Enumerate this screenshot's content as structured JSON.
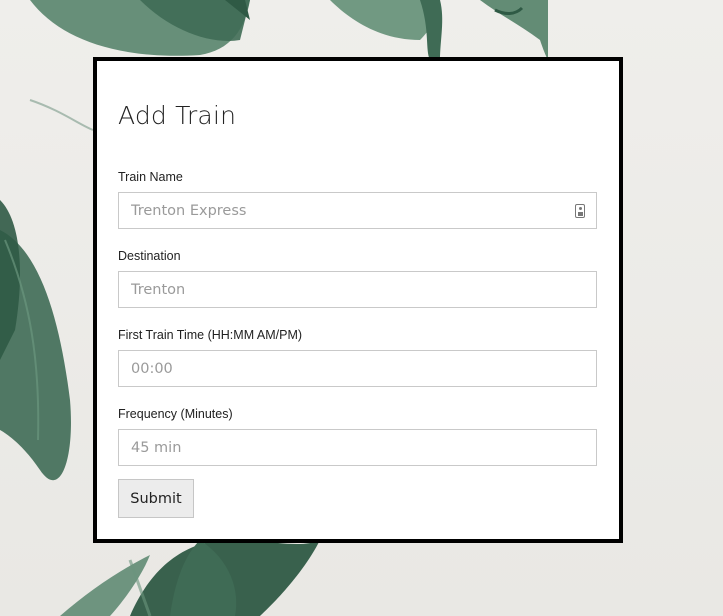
{
  "form": {
    "title": "Add Train",
    "fields": [
      {
        "label": "Train Name",
        "placeholder": "Trenton Express",
        "icon": "contact-card-icon"
      },
      {
        "label": "Destination",
        "placeholder": "Trenton"
      },
      {
        "label": "First Train Time (HH:MM AM/PM)",
        "placeholder": "00:00"
      },
      {
        "label": "Frequency (Minutes)",
        "placeholder": "45 min"
      }
    ],
    "submit_label": "Submit"
  },
  "colors": {
    "card_border": "#000000",
    "card_background": "#ffffff",
    "leaf_green": "#3f6b55",
    "page_background": "#ecebe8"
  }
}
